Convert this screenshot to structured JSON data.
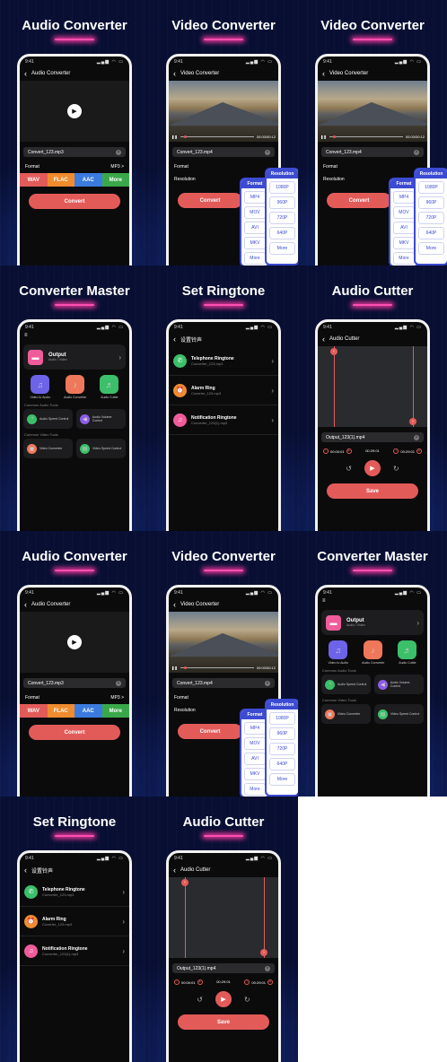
{
  "status": {
    "time": "9:41",
    "icons": "▂▄▆ ◠ ▭"
  },
  "audio_converter": {
    "title": "Audio Converter",
    "header": "Audio Converter",
    "file": "Convert_123.mp3",
    "format_label": "Format",
    "format_value": "MP3 >",
    "formats": [
      "WAV",
      "FLAC",
      "AAC",
      "More"
    ],
    "format_colors": [
      "#e35b59",
      "#f08c2e",
      "#3b7be0",
      "#3aa84a"
    ],
    "convert": "Convert"
  },
  "video_converter": {
    "title": "Video Converter",
    "header": "Video Converter",
    "file": "Convert_123.mp4",
    "time": "00:00/00:12",
    "format_label": "Format",
    "resolution_label": "Resolution",
    "convert": "Convert",
    "format_menu": {
      "header": "Format",
      "options": [
        "MP4",
        "MOV",
        "AVI",
        "MKV",
        "More"
      ]
    },
    "resolution_menu": {
      "header": "Resolution",
      "options": [
        "1080P",
        "960P",
        "720P",
        "640P",
        "More"
      ]
    }
  },
  "converter_master": {
    "title": "Converter Master",
    "output_title": "Output",
    "output_sub": "Audio / Video",
    "tools": [
      "Video to Audio",
      "Audio Converter",
      "Audio Cutter"
    ],
    "audio_section": "Common Audio Tools",
    "audio_tools": [
      "Audio Speed Control",
      "Audio Volume Control"
    ],
    "video_section": "Common Video Tools",
    "video_tools": [
      "Video Converter",
      "Video Speed Control"
    ]
  },
  "ringtone": {
    "title": "Set Ringtone",
    "header": "设置铃声",
    "items": [
      {
        "title": "Telephone Ringtone",
        "sub": "Converter_123.mp3"
      },
      {
        "title": "Alarm Ring",
        "sub": "Coverter_123.mp3"
      },
      {
        "title": "Notification Ringtone",
        "sub": "Converter_123(1).mp3"
      }
    ]
  },
  "cutter": {
    "title": "Audio Cutter",
    "header": "Audio Cutter",
    "file": "Output_123(1).mp4",
    "start": "00:00:01",
    "mid": "00:29:01",
    "end": "00:29:01",
    "save": "Save"
  }
}
